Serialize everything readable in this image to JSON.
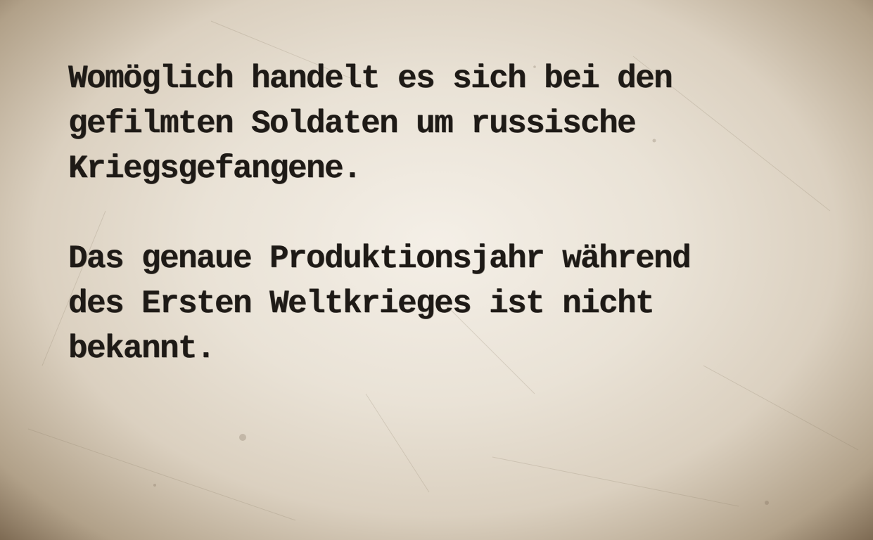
{
  "paragraphs": [
    {
      "lines": [
        "Womöglich handelt es sich bei den",
        "gefilmten Soldaten um russische",
        "Kriegsgefangene."
      ]
    },
    {
      "lines": [
        "Das genaue Produktionsjahr während",
        "des Ersten Weltkrieges ist nicht",
        "bekannt."
      ]
    }
  ],
  "colors": {
    "paper": "#e6ded1",
    "paper_edge": "#78644c",
    "ink": "#1e1a16"
  }
}
